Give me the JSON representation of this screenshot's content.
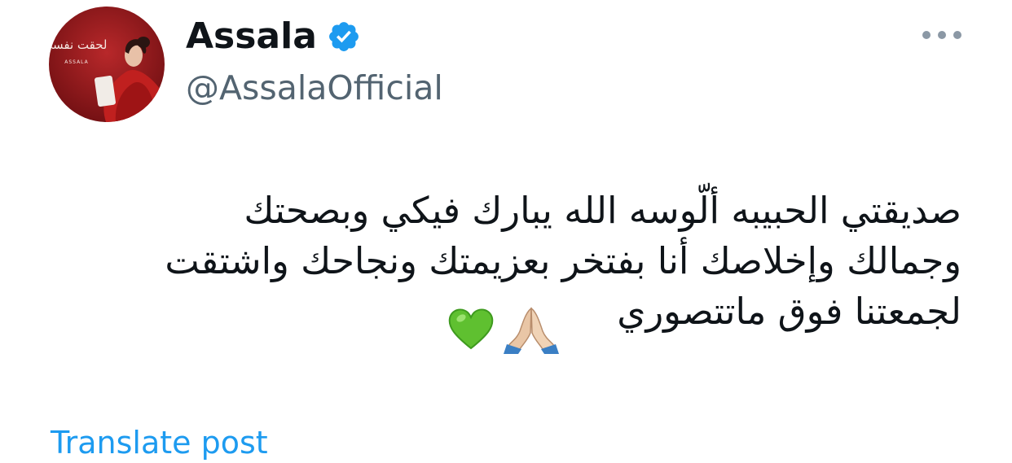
{
  "author": {
    "display_name": "Assala",
    "handle": "@AssalaOfficial",
    "verified": true,
    "avatar_text_arabic": "لحقت نفسي",
    "avatar_text_latin": "ASSALA"
  },
  "icons": {
    "more": "more-options-icon",
    "verified": "verified-badge-icon",
    "emoji_1": "folded-hands-emoji",
    "emoji_2": "green-heart-emoji"
  },
  "post": {
    "text": "صديقتي الحبيبه ألّوسه الله يبارك فيكي وبصحتك\nوجمالك وإخلاصك أنا بفتخر بعزيمتك ونجاحك واشتقت\nلجمعتنا فوق ماتتصوري",
    "translate_label": "Translate post"
  },
  "colors": {
    "text_primary": "#0f1419",
    "text_secondary": "#536471",
    "link": "#1d9bf0",
    "verified_badge": "#1d9bf0"
  }
}
